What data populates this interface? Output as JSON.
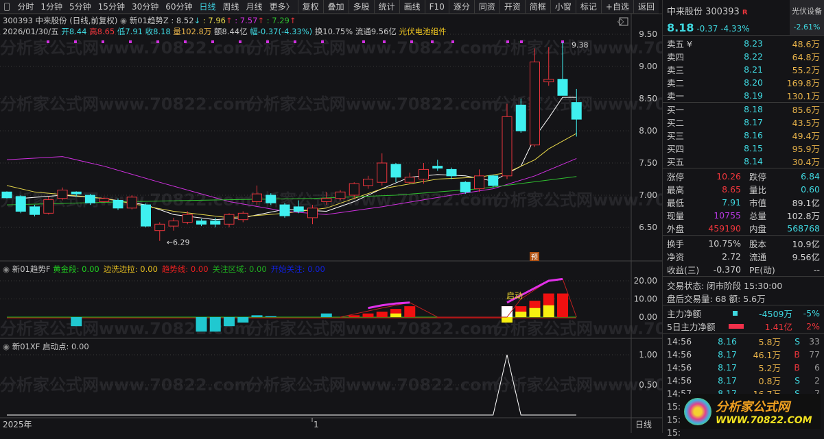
{
  "toolbar": {
    "periods": [
      "分时",
      "1分钟",
      "5分钟",
      "15分钟",
      "30分钟",
      "60分钟",
      "日线",
      "周线",
      "月线",
      "更多〉"
    ],
    "active": "日线",
    "buttons": [
      "复权",
      "叠加",
      "多股",
      "统计",
      "画线",
      "F10",
      "逐分",
      "同资",
      "开资",
      "简框",
      "小窗",
      "标记",
      "+自选",
      "返回"
    ]
  },
  "info": {
    "title": "300393 中来股份 (日线,前复权)",
    "indicator": "新01趋势Z : 8.52",
    "v1": ": 7.96",
    "v2": ": 7.57",
    "v3": ": 7.29",
    "date": "2026/01/30/五",
    "open": "开8.44",
    "high": "高8.65",
    "low": "低7.91",
    "close": "收8.18",
    "vol": "量102.8万",
    "amt": "额8.44亿",
    "chg": "幅-0.37(-4.33%)",
    "turn": "换10.75%",
    "float": "流通9.56亿",
    "sector": "光伏电池组件"
  },
  "watermark": "分析家公式网www.70822.com",
  "chart_data": {
    "type": "candlestick",
    "price_axis": {
      "ticks": [
        "9.50",
        "9.00",
        "8.50",
        "8.00",
        "7.50",
        "7.00",
        "6.50"
      ],
      "range": [
        6.05,
        9.6
      ]
    },
    "candles": [
      [
        7.05,
        7.06,
        6.95,
        6.96
      ],
      [
        6.98,
        7.0,
        6.72,
        6.75
      ],
      [
        6.82,
        6.85,
        6.67,
        6.7
      ],
      [
        6.72,
        6.98,
        6.7,
        6.93
      ],
      [
        6.95,
        7.12,
        6.92,
        7.08
      ],
      [
        7.05,
        7.06,
        6.98,
        7.02
      ],
      [
        7.0,
        7.02,
        6.85,
        6.88
      ],
      [
        6.9,
        6.98,
        6.88,
        6.95
      ],
      [
        6.92,
        6.95,
        6.77,
        6.8
      ],
      [
        6.8,
        7.0,
        6.78,
        6.97
      ],
      [
        6.85,
        6.87,
        6.5,
        6.52
      ],
      [
        6.45,
        6.58,
        6.29,
        6.55
      ],
      [
        6.52,
        6.65,
        6.45,
        6.6
      ],
      [
        6.58,
        6.75,
        6.55,
        6.7
      ],
      [
        6.6,
        6.63,
        6.52,
        6.55
      ],
      [
        6.6,
        6.65,
        6.5,
        6.55
      ],
      [
        6.55,
        6.72,
        6.5,
        6.7
      ],
      [
        6.62,
        6.75,
        6.58,
        6.72
      ],
      [
        6.9,
        7.15,
        6.85,
        7.02
      ],
      [
        7.0,
        7.03,
        6.85,
        6.88
      ],
      [
        6.85,
        6.88,
        6.65,
        6.68
      ],
      [
        6.82,
        6.92,
        6.72,
        6.75
      ],
      [
        6.65,
        6.85,
        6.55,
        6.8
      ],
      [
        6.9,
        7.05,
        6.85,
        6.95
      ],
      [
        6.95,
        7.08,
        6.92,
        7.05
      ],
      [
        7.0,
        7.2,
        6.95,
        7.18
      ],
      [
        7.15,
        7.3,
        7.1,
        7.25
      ],
      [
        7.2,
        7.65,
        7.15,
        7.5
      ],
      [
        7.48,
        7.5,
        7.2,
        7.28
      ],
      [
        7.2,
        7.35,
        7.18,
        7.28
      ],
      [
        7.25,
        7.5,
        7.18,
        7.4
      ],
      [
        7.45,
        7.55,
        7.38,
        7.42
      ],
      [
        7.4,
        7.43,
        7.25,
        7.3
      ],
      [
        7.2,
        7.22,
        7.02,
        7.05
      ],
      [
        7.1,
        7.4,
        7.05,
        7.3
      ],
      [
        7.3,
        7.32,
        7.12,
        7.15
      ],
      [
        7.3,
        8.42,
        7.25,
        8.22
      ],
      [
        8.4,
        8.5,
        7.97,
        8.0
      ],
      [
        7.78,
        9.28,
        7.75,
        9.07
      ],
      [
        8.76,
        9.3,
        8.7,
        8.8
      ],
      [
        8.8,
        9.38,
        8.55,
        8.55
      ],
      [
        8.44,
        8.65,
        7.91,
        8.18
      ]
    ],
    "ma": [
      {
        "name": "MA5",
        "color": "#ffffff",
        "points": [
          [
            1,
            6.95
          ],
          [
            4,
            7.0
          ],
          [
            7,
            6.95
          ],
          [
            10,
            6.85
          ],
          [
            12,
            6.7
          ],
          [
            15,
            6.62
          ],
          [
            17,
            6.65
          ],
          [
            20,
            6.78
          ],
          [
            23,
            6.75
          ],
          [
            25,
            6.9
          ],
          [
            27,
            7.1
          ],
          [
            29,
            7.28
          ],
          [
            31,
            7.32
          ],
          [
            33,
            7.3
          ],
          [
            35,
            7.22
          ],
          [
            37,
            7.45
          ],
          [
            38,
            7.9
          ],
          [
            39,
            8.2
          ],
          [
            40,
            8.52
          ],
          [
            41,
            8.52
          ]
        ]
      },
      {
        "name": "MA10",
        "color": "#e8d84a",
        "points": [
          [
            0,
            7.15
          ],
          [
            2,
            7.05
          ],
          [
            7,
            6.95
          ],
          [
            12,
            6.75
          ],
          [
            16,
            6.65
          ],
          [
            20,
            6.72
          ],
          [
            23,
            6.8
          ],
          [
            27,
            7.1
          ],
          [
            31,
            7.25
          ],
          [
            34,
            7.28
          ],
          [
            36,
            7.35
          ],
          [
            38,
            7.55
          ],
          [
            39,
            7.72
          ],
          [
            41,
            7.96
          ]
        ]
      },
      {
        "name": "MA20",
        "color": "#d030e0",
        "points": [
          [
            0,
            7.55
          ],
          [
            4,
            7.6
          ],
          [
            7,
            7.45
          ],
          [
            11,
            7.2
          ],
          [
            16,
            6.9
          ],
          [
            20,
            6.75
          ],
          [
            23,
            6.7
          ],
          [
            27,
            6.82
          ],
          [
            32,
            7.0
          ],
          [
            35,
            7.1
          ],
          [
            38,
            7.3
          ],
          [
            41,
            7.57
          ]
        ]
      },
      {
        "name": "MA60",
        "color": "#30c030",
        "points": [
          [
            0,
            6.85
          ],
          [
            9,
            6.9
          ],
          [
            16,
            6.93
          ],
          [
            22,
            6.95
          ],
          [
            28,
            7.0
          ],
          [
            34,
            7.1
          ],
          [
            41,
            7.29
          ]
        ]
      }
    ],
    "annotations": [
      {
        "label": "9.38",
        "index": 40,
        "value": 9.38
      },
      {
        "label": "6.29",
        "index": 11,
        "value": 6.29
      }
    ],
    "marker": "预"
  },
  "panel1": {
    "name": "新01趋势F",
    "labels": [
      {
        "t": "黄金段: 0.00",
        "c": "#20d020"
      },
      {
        "t": "边洗边拉: 0.00",
        "c": "#e8c020"
      },
      {
        "t": "趋势线: 0.00",
        "c": "#f02020"
      },
      {
        "t": "关注区域: 0.00",
        "c": "#20b020"
      },
      {
        "t": "开始关注: 0.00",
        "c": "#1020e0"
      }
    ],
    "ticks": [
      "20.00",
      "10.00",
      "0.00"
    ],
    "range": [
      -10,
      24
    ],
    "tag": "启动",
    "cyan_bars": [
      [
        5,
        -5
      ],
      [
        14,
        -8
      ],
      [
        15,
        -8
      ],
      [
        16,
        -5
      ],
      [
        17,
        -3
      ],
      [
        18,
        1
      ],
      [
        19,
        0.5
      ],
      [
        23,
        2
      ]
    ],
    "red_bars": [
      [
        25,
        1
      ],
      [
        26,
        2
      ],
      [
        27,
        3
      ],
      [
        28,
        4.5
      ],
      [
        29,
        6
      ],
      [
        36,
        6
      ],
      [
        37,
        6
      ],
      [
        38,
        9
      ],
      [
        39,
        13
      ],
      [
        40,
        13
      ]
    ],
    "yellow_bars": [
      [
        28,
        2
      ],
      [
        36,
        -3
      ],
      [
        37,
        3
      ],
      [
        38,
        5
      ],
      [
        39,
        6.5
      ]
    ],
    "white_bars": [
      [
        36,
        6
      ]
    ],
    "magenta_line": [
      [
        26,
        5
      ],
      [
        27,
        6.5
      ],
      [
        28,
        7.5
      ],
      [
        29,
        8
      ],
      [
        36,
        8
      ],
      [
        37,
        12
      ],
      [
        38,
        16
      ],
      [
        39,
        20
      ],
      [
        40,
        21
      ]
    ],
    "trend_line": [
      [
        24,
        0
      ],
      [
        27,
        5
      ],
      [
        29,
        8
      ],
      [
        31,
        0
      ],
      [
        35,
        0
      ],
      [
        36,
        0
      ],
      [
        37,
        10
      ],
      [
        39,
        20
      ],
      [
        40,
        21
      ],
      [
        41,
        0
      ]
    ]
  },
  "panel2": {
    "name": "新01XF",
    "label": "启动点: 0.00",
    "ticks": [
      "1.00",
      "0.50"
    ],
    "spike_index": 36,
    "spike_value": 1.0
  },
  "xaxis": {
    "left": "2025年",
    "mid": "1",
    "right": "日线"
  },
  "quote": {
    "name": "中来股份 300393",
    "badge": "R",
    "price": "8.18",
    "chg": "-0.37",
    "pct": "-4.33%",
    "sector": "光伏设备",
    "sector_pct": "-2.61%"
  },
  "asks": [
    {
      "l": "卖五 ¥",
      "p": "8.23",
      "v": "48.6万"
    },
    {
      "l": "卖四",
      "p": "8.22",
      "v": "64.8万"
    },
    {
      "l": "卖三",
      "p": "8.21",
      "v": "55.2万"
    },
    {
      "l": "卖二",
      "p": "8.20",
      "v": "169.8万"
    },
    {
      "l": "卖一",
      "p": "8.19",
      "v": "130.1万"
    }
  ],
  "bids": [
    {
      "l": "买一",
      "p": "8.18",
      "v": "85.6万"
    },
    {
      "l": "买二",
      "p": "8.17",
      "v": "43.5万"
    },
    {
      "l": "买三",
      "p": "8.16",
      "v": "49.4万"
    },
    {
      "l": "买四",
      "p": "8.15",
      "v": "95.9万"
    },
    {
      "l": "买五",
      "p": "8.14",
      "v": "30.4万"
    }
  ],
  "stats1": [
    [
      "涨停",
      "10.26",
      "red",
      "跌停",
      "6.84",
      "cyan"
    ],
    [
      "最高",
      "8.65",
      "red",
      "量比",
      "0.60",
      "cyan"
    ],
    [
      "最低",
      "7.91",
      "cyan",
      "市值",
      "89.1亿",
      "white"
    ],
    [
      "现量",
      "10755",
      "mag",
      "总量",
      "102.8万",
      "white"
    ],
    [
      "外盘",
      "459190",
      "red",
      "内盘",
      "568768",
      "cyan"
    ]
  ],
  "stats2": [
    [
      "换手",
      "10.75%",
      "white",
      "股本",
      "10.9亿",
      "white"
    ],
    [
      "净资",
      "2.72",
      "white",
      "流通",
      "9.56亿",
      "white"
    ],
    [
      "收益(三)",
      "-0.370",
      "white",
      "PE(动)",
      "--",
      "white"
    ]
  ],
  "status": {
    "state": "交易状态: 闭市阶段 15:30:00",
    "after": "盘后交易量: 68  额: 5.6万"
  },
  "flow": [
    {
      "l": "主力净额",
      "v": "-4509万",
      "p": "-5%",
      "c": "cyan"
    },
    {
      "l": "5日主力净额",
      "v": "1.41亿",
      "p": "2%",
      "c": "red"
    }
  ],
  "ticks": [
    [
      "14:56",
      "8.16",
      "5.8万",
      "S",
      "33"
    ],
    [
      "14:56",
      "8.17",
      "46.1万",
      "B",
      "77"
    ],
    [
      "14:56",
      "8.17",
      "5.2万",
      "B",
      "6"
    ],
    [
      "14:56",
      "8.17",
      "0.8万",
      "S",
      "2"
    ],
    [
      "14:57",
      "8.17",
      "16.7万",
      "S",
      "7"
    ],
    [
      "15:",
      "",
      "",
      "",
      ""
    ],
    [
      "15:",
      "",
      "",
      "",
      ""
    ],
    [
      "15:",
      "",
      "",
      "",
      ""
    ]
  ],
  "logo": {
    "title": "分析家公式网",
    "url": "WWW.70822.COM"
  }
}
